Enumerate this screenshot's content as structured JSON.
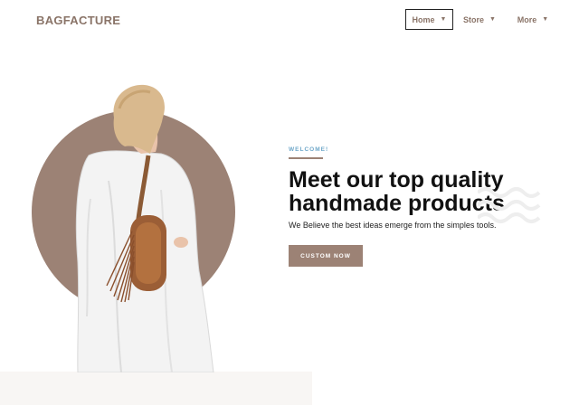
{
  "header": {
    "logo": "BAGFACTURE",
    "nav": [
      {
        "label": "Home"
      },
      {
        "label": "Store"
      },
      {
        "label": "More"
      }
    ]
  },
  "hero": {
    "eyebrow": "WELCOME!",
    "title_line1": "Meet our top quality",
    "title_line2": "handmade products",
    "subtitle": "We Believe the best ideas emerge from the simples tools.",
    "cta_label": "CUSTOM NOW"
  },
  "icons": {
    "nav_chevron": "chevron-down-icon",
    "decoration": "wave-pattern-icon"
  },
  "colors": {
    "brand": "#9c8275",
    "logo": "#8a7468",
    "eyebrow": "#6ea7c9",
    "heading": "#111111",
    "band": "#f8f6f4"
  }
}
